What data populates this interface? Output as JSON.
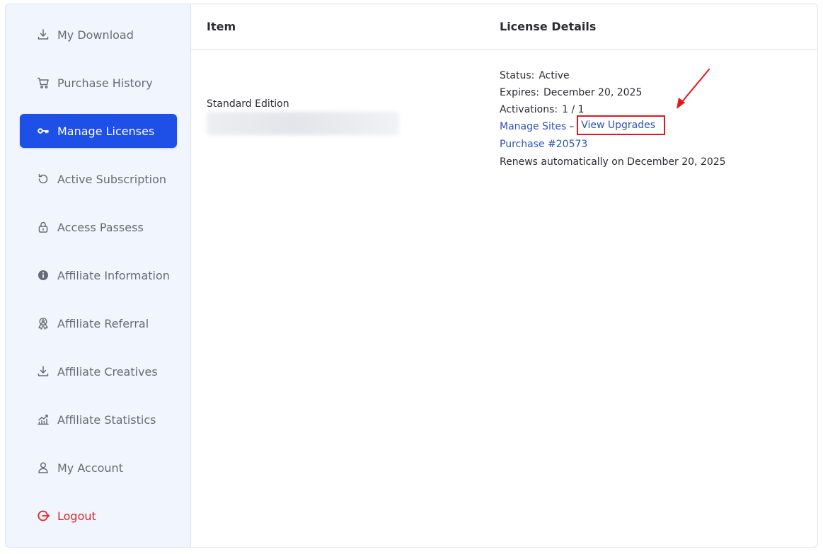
{
  "sidebar": {
    "items": [
      {
        "label": "My Download",
        "icon": "download-icon",
        "active": false
      },
      {
        "label": "Purchase History",
        "icon": "cart-icon",
        "active": false
      },
      {
        "label": "Manage Licenses",
        "icon": "key-icon",
        "active": true
      },
      {
        "label": "Active Subscription",
        "icon": "refresh-icon",
        "active": false
      },
      {
        "label": "Access Passess",
        "icon": "lock-icon",
        "active": false
      },
      {
        "label": "Affiliate Information",
        "icon": "info-icon",
        "active": false
      },
      {
        "label": "Affiliate Referral",
        "icon": "referral-icon",
        "active": false
      },
      {
        "label": "Affiliate Creatives",
        "icon": "download-icon",
        "active": false
      },
      {
        "label": "Affiliate Statistics",
        "icon": "stats-icon",
        "active": false
      },
      {
        "label": "My Account",
        "icon": "user-icon",
        "active": false
      },
      {
        "label": "Logout",
        "icon": "logout-icon",
        "active": false
      }
    ]
  },
  "table": {
    "headers": {
      "item": "Item",
      "details": "License Details"
    },
    "row": {
      "item_name": "Standard Edition",
      "status_label": "Status:",
      "status_value": "Active",
      "expires_label": "Expires:",
      "expires_value": "December 20, 2025",
      "activations_label": "Activations:",
      "activations_value": "1 / 1",
      "manage_sites": "Manage Sites",
      "separator": "–",
      "view_upgrades": "View Upgrades",
      "purchase": "Purchase #20573",
      "renews": "Renews automatically on December 20, 2025"
    }
  },
  "colors": {
    "accent": "#1e4fe6",
    "link": "#2a52be",
    "logout": "#e02424",
    "annotation": "#e8131b",
    "sidebar_bg": "#f0f5fe"
  }
}
